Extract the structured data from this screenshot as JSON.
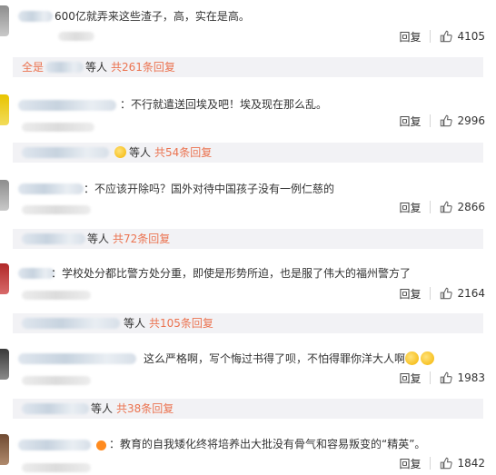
{
  "comments": [
    {
      "text": "600亿就弄来这些渣子，高，实在是高。",
      "reply_label": "回复",
      "likes": "4105",
      "replybar": {
        "prefix": "全是",
        "mid": "等人",
        "link": "共261条回复"
      }
    },
    {
      "text": "：不行就遣送回埃及吧！埃及现在那么乱。",
      "reply_label": "回复",
      "likes": "2996",
      "replybar": {
        "mid": "等人",
        "link": "共54条回复"
      }
    },
    {
      "text": "：不应该开除吗？国外对待中国孩子没有一例仁慈的",
      "reply_label": "回复",
      "likes": "2866",
      "replybar": {
        "mid": "等人",
        "link": "共72条回复"
      }
    },
    {
      "text": "：学校处分都比警方处分重，即使是形势所迫，也是服了伟大的福州警方了",
      "reply_label": "回复",
      "likes": "2164",
      "replybar": {
        "mid": "等人",
        "link": "共105条回复"
      }
    },
    {
      "text": "这么严格啊，写个悔过书得了呗，不怕得罪你洋大人啊",
      "reply_label": "回复",
      "likes": "1983",
      "replybar": {
        "mid": "等人",
        "link": "共38条回复"
      }
    },
    {
      "text": "：教育的自我矮化终将培养出大批没有骨气和容易叛变的“精英”。",
      "reply_label": "回复",
      "likes": "1842"
    }
  ],
  "icons": {
    "like": "thumbs-up-icon",
    "emoji": "smiley-emoji-icon"
  },
  "colors": {
    "link": "#eb7350",
    "reply_bg": "#f2f2f5"
  }
}
